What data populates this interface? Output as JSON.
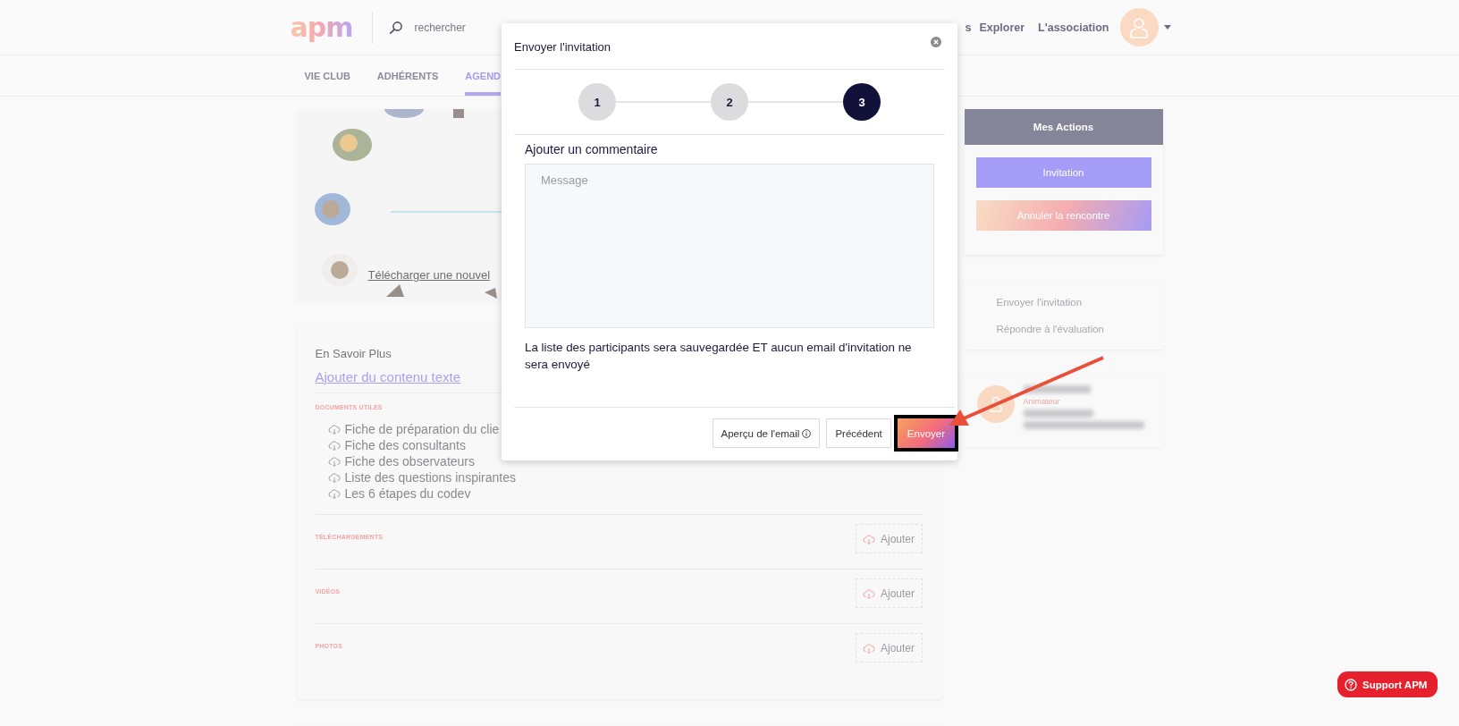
{
  "header": {
    "logo": "apm",
    "search": {
      "placeholder": "rechercher"
    },
    "nav": [
      "s",
      "Explorer",
      "L'association"
    ]
  },
  "tabs": [
    {
      "label": "VIE CLUB",
      "selected": false
    },
    {
      "label": "ADHÉRENTS",
      "selected": false
    },
    {
      "label": "AGEND",
      "selected": true
    }
  ],
  "banner": {
    "kind": "picture",
    "link": "Télécharger une nouvel"
  },
  "details": {
    "title": "En Savoir Plus",
    "add_text_link": "Ajouter du contenu texte",
    "documents": {
      "heading": "DOCUMENTS UTILES",
      "items": [
        "Fiche de préparation du clie",
        "Fiche des consultants",
        "Fiche des observateurs",
        "Liste des questions inspirantes",
        "Les 6 étapes du codev"
      ]
    },
    "sections": [
      {
        "heading": "TÉLÉCHARGEMENTS",
        "button": "Ajouter"
      },
      {
        "heading": "VIDÉOS",
        "button": "Ajouter"
      },
      {
        "heading": "PHOTOS",
        "button": "Ajouter"
      }
    ]
  },
  "actions": {
    "title": "Mes Actions",
    "buttons": [
      {
        "label": "Invitation",
        "kind": "solid"
      },
      {
        "label": "Annuler la rencontre",
        "kind": "gradient"
      }
    ]
  },
  "steps_card": {
    "items": [
      "Envoyer l'invitation",
      "Répondre à l'évaluation"
    ]
  },
  "organizer": {
    "role": "Animateur"
  },
  "modal": {
    "title": "Envoyer l'invitation",
    "steps": [
      {
        "label": "1",
        "selected": false
      },
      {
        "label": "2",
        "selected": false
      },
      {
        "label": "3",
        "selected": true
      }
    ],
    "comment_label": "Ajouter un commentaire",
    "message": {
      "placeholder": "Message"
    },
    "notice": "La liste des participants sera sauvegardée ET aucun email d'invitation ne sera envoyé",
    "buttons": [
      {
        "label": "Aperçu de l'email",
        "kind": "info",
        "highlighted": false
      },
      {
        "label": "Précédent",
        "kind": "plain",
        "highlighted": false
      },
      {
        "label": "Envoyer",
        "kind": "primary",
        "highlighted": true
      }
    ]
  },
  "support": {
    "label": "Support APM"
  }
}
